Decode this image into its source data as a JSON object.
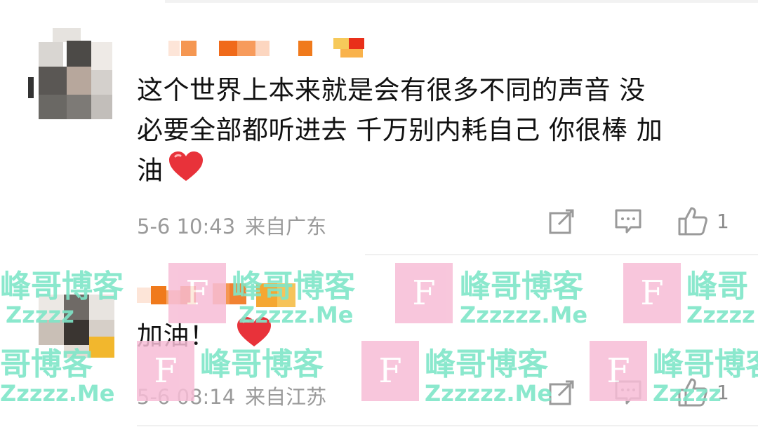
{
  "comments": [
    {
      "text_line1": "这个世界上本来就是会有很多不同的声音 没",
      "text_line2": "必要全部都听进去 千万别内耗自己 你很棒 加",
      "text_line3": "油",
      "heart_icon": "red-heart-emoji",
      "time": "5-6 10:43",
      "location": "来自广东",
      "like_count": "1"
    },
    {
      "text": "加油！",
      "heart_icon": "red-heart-emoji",
      "time": "5-6 08:14",
      "location": "来自江苏",
      "like_count": "1"
    }
  ],
  "watermark": {
    "title": "峰哥博客",
    "subtitle": "Zzzzzz.Me",
    "logo_letter": "F",
    "title_partial_a": "峰哥",
    "title_partial_b": "哥博客",
    "subtitle_partial_a": "Zzzzz.Me",
    "subtitle_partial_b": "Zzzzz",
    "colors": {
      "text": "#7fe6c8",
      "box": "#f7bdd6"
    }
  },
  "colors": {
    "text": "#111111",
    "meta": "#9a9a9a",
    "heart": "#e8323a"
  }
}
